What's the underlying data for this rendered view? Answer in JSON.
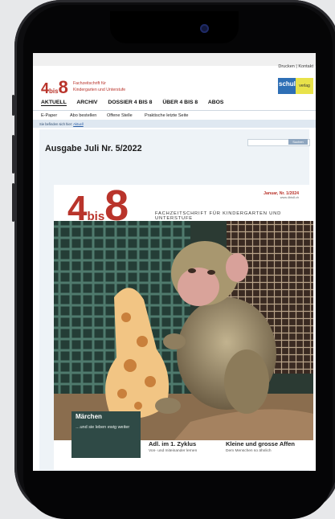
{
  "header": {
    "util_links": "Drucken | Kontakt",
    "logo_four": "4",
    "logo_bis": "bis",
    "logo_eight": "8",
    "logo_tagline_1": "Fachzeitschrift für",
    "logo_tagline_2": "Kindergarten und Unterstufe",
    "partner_logo_1": "schul",
    "partner_logo_2": "verlag"
  },
  "mainnav": [
    "AKTUELL",
    "ARCHIV",
    "DOSSIER 4 BIS 8",
    "ÜBER 4 BIS 8",
    "ABOS"
  ],
  "subnav": [
    "E-Paper",
    "Abo bestellen",
    "Offene Stelle",
    "Praktische letzte Seite"
  ],
  "breadcrumb": {
    "prefix": "Sie befinden sich hier:",
    "current": "Aktuell"
  },
  "search": {
    "button": "Suchen"
  },
  "page": {
    "title": "Ausgabe Juli Nr. 5/2022"
  },
  "cover": {
    "four": "4",
    "bis": "bis",
    "eight": "8",
    "subtitle": "FACHZEITSCHRIFT FÜR KINDERGARTEN UND UNTERSTUFE",
    "issue": "Januar, Nr. 1/2024",
    "website": "www.4bis8.ch",
    "feature_title": "Märchen",
    "feature_text": "…und sie leben ewig weiter",
    "story1_title": "Adl. im 1. Zyklus",
    "story1_sub": "Von- und miteinander lernen",
    "story2_title": "Kleine und grosse Affen",
    "story2_sub": "Dem Menschen so ähnlich"
  },
  "colors": {
    "brand_red": "#b9342b",
    "feature_box": "#2f4a46",
    "nav_bg": "#dfe8f1"
  }
}
